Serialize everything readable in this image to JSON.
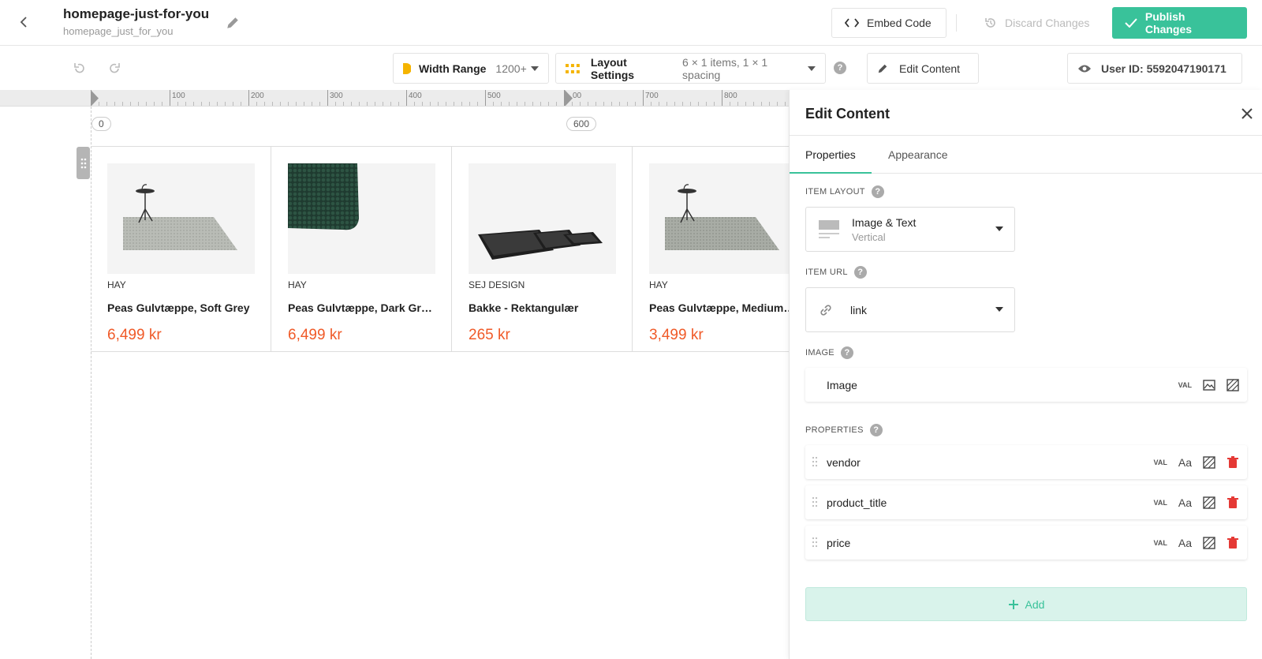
{
  "header": {
    "title": "homepage-just-for-you",
    "subtitle": "homepage_just_for_you",
    "embed_label": "Embed Code",
    "discard_label": "Discard Changes",
    "publish_label": "Publish Changes"
  },
  "toolbar": {
    "width_range_label": "Width Range",
    "width_range_value": "1200+",
    "layout_settings_label": "Layout Settings",
    "layout_settings_value": "6 × 1 items, 1 × 1 spacing",
    "help": "?",
    "edit_content_label": "Edit Content",
    "user_id_label": "User ID: 5592047190171"
  },
  "ruler": {
    "labels": [
      "100",
      "200",
      "300",
      "400",
      "500",
      "00",
      "700",
      "800"
    ],
    "start_badge": "0",
    "mid_badge": "600"
  },
  "products": [
    {
      "vendor": "HAY",
      "title": "Peas Gulvtæppe, Soft Grey",
      "price": "6,499 kr",
      "image": "rug-with-side-table"
    },
    {
      "vendor": "HAY",
      "title": "Peas Gulvtæppe, Dark Gr…",
      "price": "6,499 kr",
      "image": "dark-green-rug-corner"
    },
    {
      "vendor": "SEJ DESIGN",
      "title": "Bakke - Rektangulær",
      "price": "265 kr",
      "image": "black-trays"
    },
    {
      "vendor": "HAY",
      "title": "Peas Gulvtæppe, Medium…",
      "price": "3,499 kr",
      "image": "rug-with-side-table"
    }
  ],
  "panel": {
    "title": "Edit Content",
    "tabs": [
      {
        "label": "Properties"
      },
      {
        "label": "Appearance"
      }
    ],
    "item_layout_label": "ITEM LAYOUT",
    "item_layout_value": "Image & Text",
    "item_layout_sub": "Vertical",
    "item_url_label": "ITEM URL",
    "item_url_value": "link",
    "image_label": "IMAGE",
    "image_field": "Image",
    "properties_label": "PROPERTIES",
    "properties": [
      {
        "name": "vendor"
      },
      {
        "name": "product_title"
      },
      {
        "name": "price"
      }
    ],
    "val_tag": "VAL",
    "aa_tag": "Aa",
    "add_label": "Add"
  },
  "colors": {
    "accent": "#39c29a",
    "price": "#f05a28",
    "delete": "#e53935",
    "width_range_icon": "#f5b400",
    "layout_icon": "#f5b400"
  }
}
